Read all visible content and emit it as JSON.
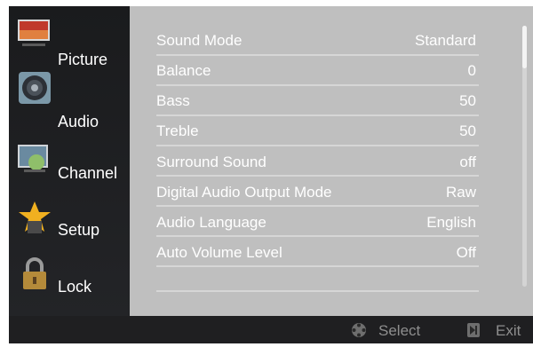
{
  "sidebar": {
    "items": [
      {
        "label": "Picture",
        "icon": "picture-icon"
      },
      {
        "label": "Audio",
        "icon": "speaker-icon"
      },
      {
        "label": "Channel",
        "icon": "satellite-icon"
      },
      {
        "label": "Setup",
        "icon": "star-icon"
      },
      {
        "label": "Lock",
        "icon": "padlock-icon"
      }
    ],
    "selected": "Audio"
  },
  "menu": {
    "rows": [
      {
        "label": "Sound Mode",
        "value": "Standard"
      },
      {
        "label": "Balance",
        "value": "0"
      },
      {
        "label": "Bass",
        "value": "50"
      },
      {
        "label": "Treble",
        "value": "50"
      },
      {
        "label": "Surround Sound",
        "value": "off"
      },
      {
        "label": "Digital Audio Output Mode",
        "value": "Raw"
      },
      {
        "label": "Audio Language",
        "value": "English"
      },
      {
        "label": "Auto Volume Level",
        "value": "Off"
      }
    ]
  },
  "footer": {
    "select_label": "Select",
    "select_icon": "dpad-icon",
    "exit_label": "Exit",
    "exit_icon": "exit-key-icon"
  },
  "colors": {
    "panel_bg": "#bfbfbf",
    "sidebar_bg": "#1f1f21",
    "text": "#ffffff",
    "footer_text": "#8e8e8e"
  }
}
